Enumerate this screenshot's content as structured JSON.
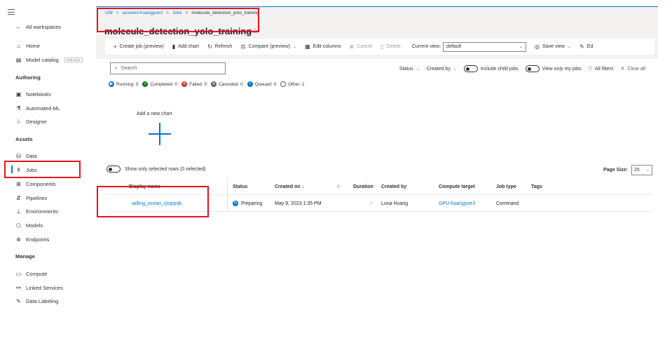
{
  "nav": {
    "all_workspaces": "All workspaces",
    "items_top": [
      {
        "label": "Home",
        "icon": "home-icon"
      },
      {
        "label": "Model catalog",
        "badge": "PREVIEW",
        "icon": "catalog-icon"
      }
    ],
    "sections": {
      "authoring": "Authoring",
      "assets": "Assets",
      "manage": "Manage"
    },
    "authoring_items": [
      "Notebooks",
      "Automated ML",
      "Designer"
    ],
    "assets_items": [
      "Data",
      "Jobs",
      "Components",
      "Pipelines",
      "Environments",
      "Models",
      "Endpoints"
    ],
    "manage_items": [
      "Compute",
      "Linked Services",
      "Data Labeling"
    ],
    "active_item": "Jobs"
  },
  "breadcrumb": {
    "items": [
      "UW",
      "azureml-huangyue3",
      "Jobs",
      "molecule_detection_yolo_training"
    ],
    "separator": ">"
  },
  "page": {
    "title": "molecule_detection_yolo_training",
    "favorite_glyph": "☆"
  },
  "toolbar": {
    "create_job": "Create job (preview)",
    "add_chart": "Add chart",
    "refresh": "Refresh",
    "compare": "Compare (preview)",
    "edit_columns": "Edit columns",
    "cancel": "Cancel",
    "delete": "Delete",
    "current_view_label": "Current view:",
    "current_view_value": "default",
    "save_view": "Save view",
    "edit": "Ed"
  },
  "search": {
    "placeholder": "Search"
  },
  "filters": {
    "status": "Status",
    "created_by": "Created by",
    "include_child_jobs": "Include child jobs",
    "view_only_my_jobs": "View only my jobs",
    "all_filters": "All filters",
    "clear_all": "Clear all"
  },
  "status_counts": [
    {
      "label": "Running: 0",
      "color": "#0078d4",
      "glyph": "▶"
    },
    {
      "label": "Completed: 0",
      "color": "#107c10",
      "glyph": "✓"
    },
    {
      "label": "Failed: 0",
      "color": "#d13438",
      "glyph": "✕"
    },
    {
      "label": "Canceled: 0",
      "color": "#605e5c",
      "glyph": "⊘"
    },
    {
      "label": "Queued: 0",
      "color": "#0078d4",
      "glyph": "•"
    },
    {
      "label": "Other: 1",
      "color": "#ffffff",
      "glyph": ""
    }
  ],
  "chart": {
    "add_new_chart": "Add a new chart"
  },
  "selection": {
    "label": "Show only selected rows (0 selected)"
  },
  "paging": {
    "label": "Page Size:",
    "value": "25"
  },
  "table": {
    "headers": {
      "display_name": "Display name",
      "status": "Status",
      "created_on": "Created on ↓",
      "star": "☆",
      "duration": "Duration",
      "created_by": "Created by",
      "compute_target": "Compute target",
      "job_type": "Job type",
      "tags": "Tags"
    },
    "rows": [
      {
        "display_name": "willing_ocean_cjspqnjk",
        "status": "Preparing",
        "created_on": "May 9, 2023 1:35 PM",
        "duration": "-",
        "created_by": "Luna Huang",
        "compute_target": "GPU-huangyue3",
        "job_type": "Command",
        "tags": ""
      }
    ]
  },
  "colors": {
    "accent": "#0078d4",
    "highlight": "#e81123"
  }
}
